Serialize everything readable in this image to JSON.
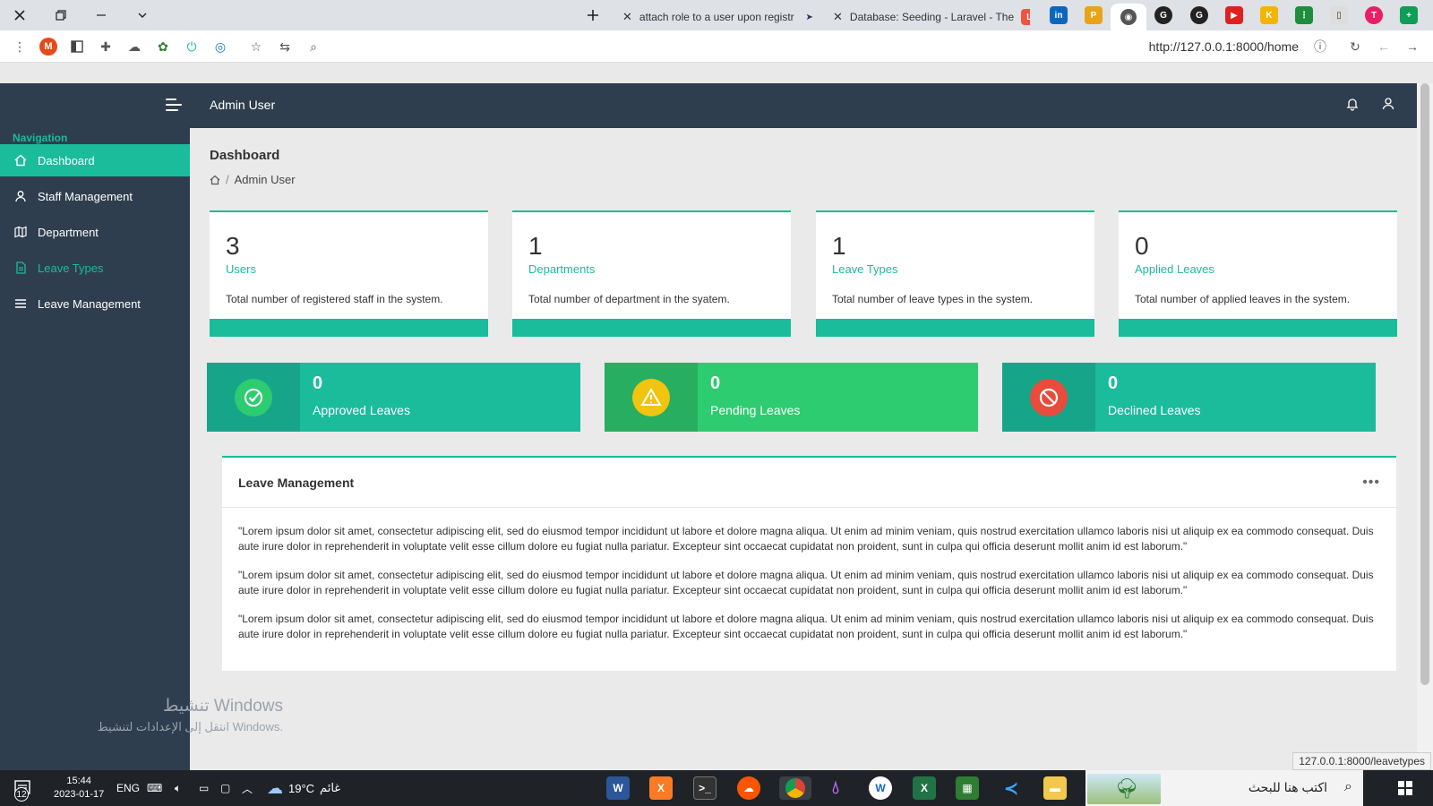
{
  "browser": {
    "tabs": [
      {
        "title": "attach role to a user upon registr"
      },
      {
        "title": "Database: Seeding - Laravel - The"
      }
    ],
    "url": "http://127.0.0.1:8000/home",
    "status_url": "127.0.0.1:8000/leavetypes"
  },
  "header": {
    "user_name": "Admin User"
  },
  "sidebar": {
    "caption": "Navigation",
    "items": [
      {
        "label": "Dashboard",
        "icon": "home-icon"
      },
      {
        "label": "Staff Management",
        "icon": "user-icon"
      },
      {
        "label": "Department",
        "icon": "map-icon"
      },
      {
        "label": "Leave Types",
        "icon": "file-icon"
      },
      {
        "label": "Leave Management",
        "icon": "list-icon"
      }
    ]
  },
  "page": {
    "title": "Dashboard",
    "breadcrumb": "Admin User"
  },
  "stats": [
    {
      "value": "3",
      "label": "Users",
      "desc": "Total number of registered staff in the system."
    },
    {
      "value": "1",
      "label": "Departments",
      "desc": "Total number of department in the syatem."
    },
    {
      "value": "1",
      "label": "Leave Types",
      "desc": "Total number of leave types in the system."
    },
    {
      "value": "0",
      "label": "Applied Leaves",
      "desc": "Total number of applied leaves in the system."
    }
  ],
  "leaves": [
    {
      "value": "0",
      "label": "Approved Leaves",
      "color": "#1abc9c"
    },
    {
      "value": "0",
      "label": "Pending Leaves",
      "color": "#2ecc71"
    },
    {
      "value": "0",
      "label": "Declined Leaves",
      "color": "#1abc9c"
    }
  ],
  "leave_management": {
    "title": "Leave Management",
    "paragraphs": [
      "\"Lorem ipsum dolor sit amet, consectetur adipiscing elit, sed do eiusmod tempor incididunt ut labore et dolore magna aliqua. Ut enim ad minim veniam, quis nostrud exercitation ullamco laboris nisi ut aliquip ex ea commodo consequat. Duis aute irure dolor in reprehenderit in voluptate velit esse cillum dolore eu fugiat nulla pariatur. Excepteur sint occaecat cupidatat non proident, sunt in culpa qui officia deserunt mollit anim id est laborum.\"",
      "\"Lorem ipsum dolor sit amet, consectetur adipiscing elit, sed do eiusmod tempor incididunt ut labore et dolore magna aliqua. Ut enim ad minim veniam, quis nostrud exercitation ullamco laboris nisi ut aliquip ex ea commodo consequat. Duis aute irure dolor in reprehenderit in voluptate velit esse cillum dolore eu fugiat nulla pariatur. Excepteur sint occaecat cupidatat non proident, sunt in culpa qui officia deserunt mollit anim id est laborum.\"",
      "\"Lorem ipsum dolor sit amet, consectetur adipiscing elit, sed do eiusmod tempor incididunt ut labore et dolore magna aliqua. Ut enim ad minim veniam, quis nostrud exercitation ullamco laboris nisi ut aliquip ex ea commodo consequat. Duis aute irure dolor in reprehenderit in voluptate velit esse cillum dolore eu fugiat nulla pariatur. Excepteur sint occaecat cupidatat non proident, sunt in culpa qui officia deserunt mollit anim id est laborum.\""
    ]
  },
  "watermark": {
    "line1": "تنشيط Windows",
    "line2": "انتقل إلى الإعدادات لتنشيط Windows."
  },
  "taskbar": {
    "notification_count": "12",
    "time": "15:44",
    "date": "2023-01-17",
    "lang": "ENG",
    "temperature": "19°C",
    "weather": "غائم",
    "search_placeholder": "اكتب هنا للبحث"
  },
  "colors": {
    "sidebar": "#2f3e4e",
    "accent": "#1abc9c",
    "pending": "#2ecc71",
    "warning": "#f1c40f",
    "danger": "#e74c3c"
  }
}
